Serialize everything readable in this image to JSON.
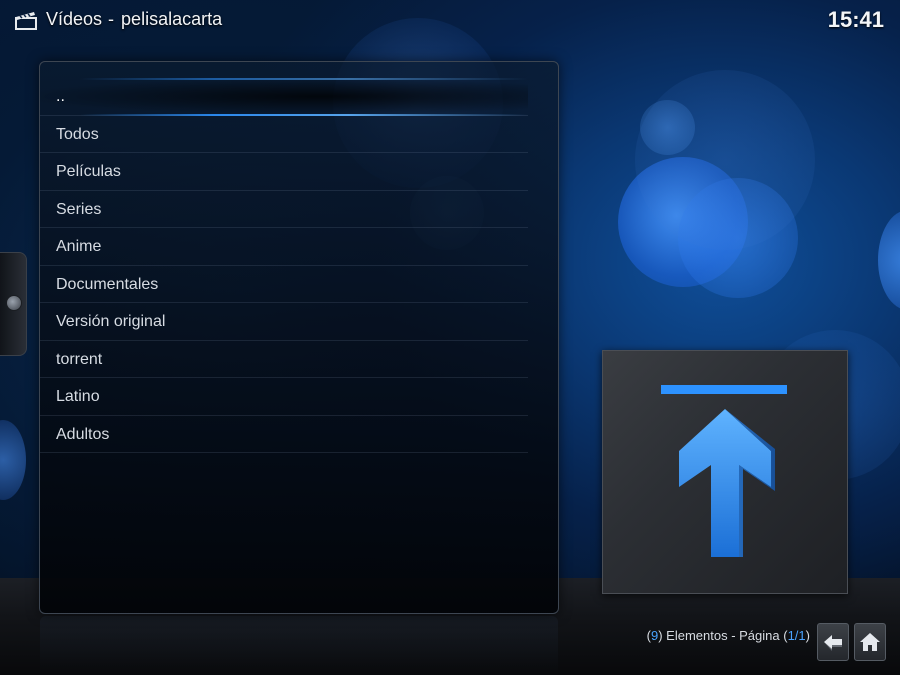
{
  "header": {
    "section": "Vídeos",
    "separator": "-",
    "addon": "pelisalacarta",
    "clock": "15:41",
    "icon": "clapperboard-icon"
  },
  "list": {
    "items": [
      {
        "label": "..",
        "focused": true
      },
      {
        "label": "Todos"
      },
      {
        "label": "Películas"
      },
      {
        "label": "Series"
      },
      {
        "label": "Anime"
      },
      {
        "label": "Documentales"
      },
      {
        "label": "Versión original"
      },
      {
        "label": "torrent"
      },
      {
        "label": "Latino"
      },
      {
        "label": "Adultos"
      }
    ]
  },
  "thumbnail": {
    "icon": "folder-up-arrow-icon"
  },
  "footer": {
    "count_open": "(",
    "count": "9",
    "count_close": ")",
    "elements_label": " Elementos - Página ",
    "page_open": "(",
    "page": "1/1",
    "page_close": ")",
    "back_icon": "back-arrow-icon",
    "home_icon": "home-icon"
  },
  "colors": {
    "accent": "#2d92ff",
    "counter_number": "#4aa3ff",
    "background_blue": "#0f4f9a"
  }
}
